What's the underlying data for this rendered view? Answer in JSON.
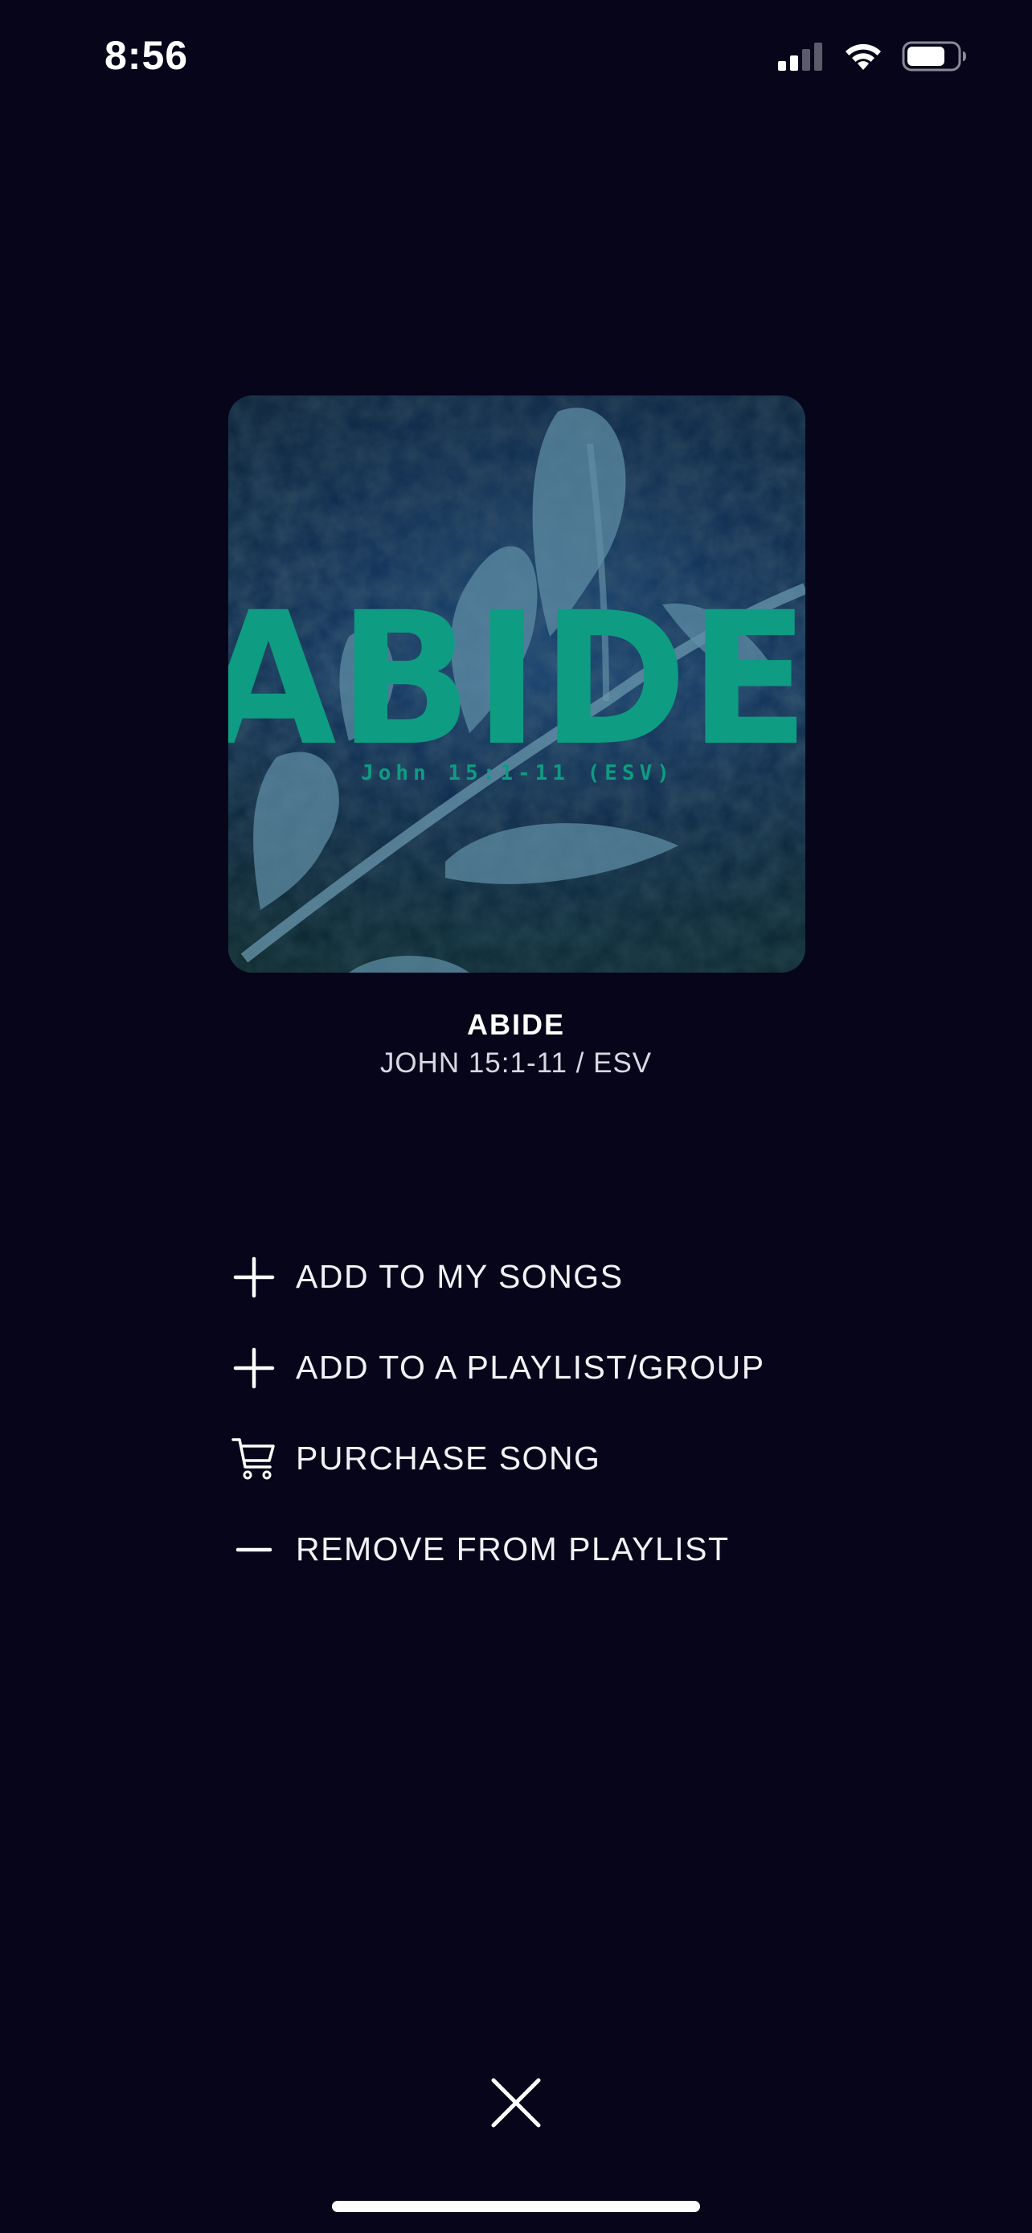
{
  "status_bar": {
    "time": "8:56"
  },
  "artwork": {
    "title_text": "ABIDE",
    "subtitle_text": "John 15:1-11 (ESV)",
    "accent_color": "#0e9c82"
  },
  "song": {
    "title": "ABIDE",
    "subtitle": "JOHN 15:1-11 / ESV"
  },
  "actions": [
    {
      "label": "ADD TO MY SONGS",
      "icon": "plus-icon"
    },
    {
      "label": "ADD TO A PLAYLIST/GROUP",
      "icon": "plus-icon"
    },
    {
      "label": "PURCHASE SONG",
      "icon": "cart-icon"
    },
    {
      "label": "REMOVE FROM PLAYLIST",
      "icon": "minus-icon"
    }
  ],
  "close": {
    "icon": "close-icon"
  },
  "colors": {
    "background": "#07051a",
    "text": "#ffffff"
  }
}
